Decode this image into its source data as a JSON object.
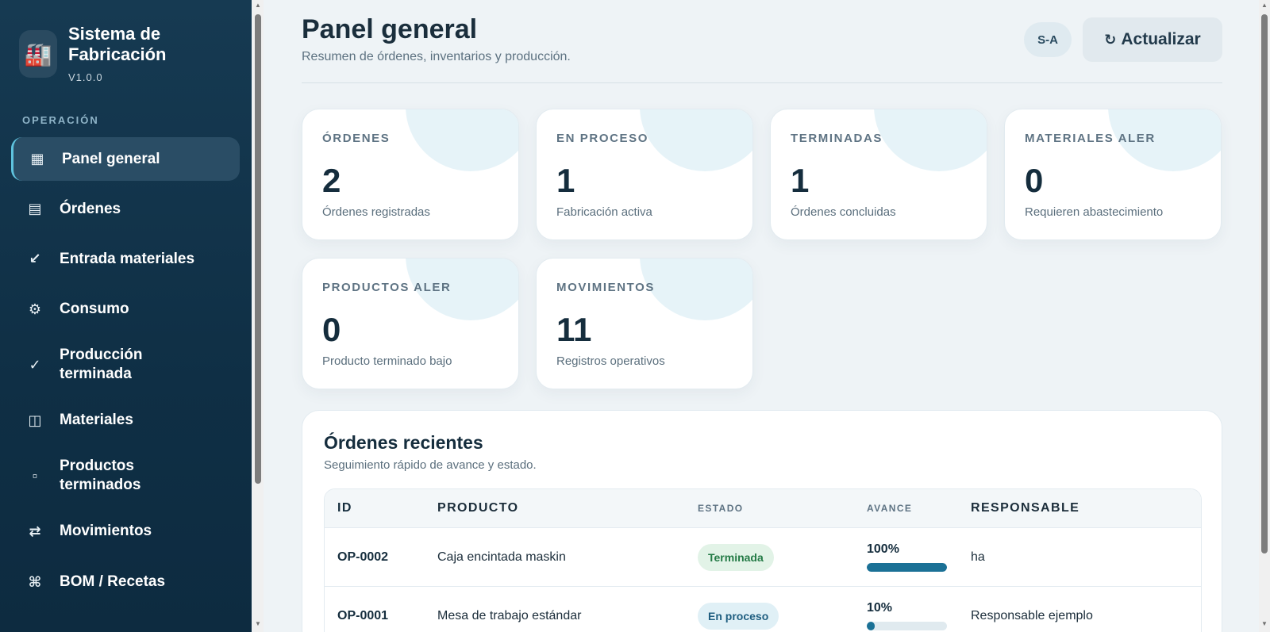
{
  "brand": {
    "logo_icon": "factory-icon",
    "title": "Sistema de Fabricación",
    "version": "V1.0.0"
  },
  "sidebar": {
    "section_label": "OPERACIÓN",
    "items": [
      {
        "icon": "▦",
        "icon_name": "dashboard-grid-icon",
        "label": "Panel general",
        "active": true
      },
      {
        "icon": "▤",
        "icon_name": "list-icon",
        "label": "Órdenes",
        "active": false
      },
      {
        "icon": "↙",
        "icon_name": "arrow-in-icon",
        "label": "Entrada materiales",
        "active": false
      },
      {
        "icon": "⚙",
        "icon_name": "gear-icon",
        "label": "Consumo",
        "active": false
      },
      {
        "icon": "✓",
        "icon_name": "check-icon",
        "label": "Producción terminada",
        "active": false
      },
      {
        "icon": "◫",
        "icon_name": "columns-icon",
        "label": "Materiales",
        "active": false
      },
      {
        "icon": "▫",
        "icon_name": "square-icon",
        "label": "Productos terminados",
        "active": false
      },
      {
        "icon": "⇄",
        "icon_name": "swap-icon",
        "label": "Movimientos",
        "active": false
      },
      {
        "icon": "⌘",
        "icon_name": "command-icon",
        "label": "BOM / Recetas",
        "active": false
      }
    ]
  },
  "header": {
    "title": "Panel general",
    "subtitle": "Resumen de órdenes, inventarios y producción.",
    "user_badge": "S-A",
    "refresh_icon": "↻",
    "refresh_label": "Actualizar"
  },
  "cards": [
    {
      "label": "ÓRDENES",
      "value": "2",
      "desc": "Órdenes registradas"
    },
    {
      "label": "EN PROCESO",
      "value": "1",
      "desc": "Fabricación activa"
    },
    {
      "label": "TERMINADAS",
      "value": "1",
      "desc": "Órdenes concluidas"
    },
    {
      "label": "MATERIALES ALER",
      "value": "0",
      "desc": "Requieren abastecimiento"
    },
    {
      "label": "PRODUCTOS ALER",
      "value": "0",
      "desc": "Producto terminado bajo"
    },
    {
      "label": "MOVIMIENTOS",
      "value": "11",
      "desc": "Registros operativos"
    }
  ],
  "recent_orders": {
    "title": "Órdenes recientes",
    "subtitle": "Seguimiento rápido de avance y estado.",
    "columns": [
      "ID",
      "PRODUCTO",
      "ESTADO",
      "AVANCE",
      "RESPONSABLE"
    ],
    "rows": [
      {
        "id": "OP-0002",
        "product": "Caja encintada maskin",
        "status": "Terminada",
        "status_kind": "done",
        "progress_label": "100%",
        "progress": 1.0,
        "owner": "ha"
      },
      {
        "id": "OP-0001",
        "product": "Mesa de trabajo estándar",
        "status": "En proceso",
        "status_kind": "proc",
        "progress_label": "10%",
        "progress": 0.1,
        "owner": "Responsable ejemplo"
      }
    ]
  },
  "colors": {
    "sidebar_bg": "#0f2f45",
    "accent": "#1b7196",
    "done": "#237a45"
  }
}
